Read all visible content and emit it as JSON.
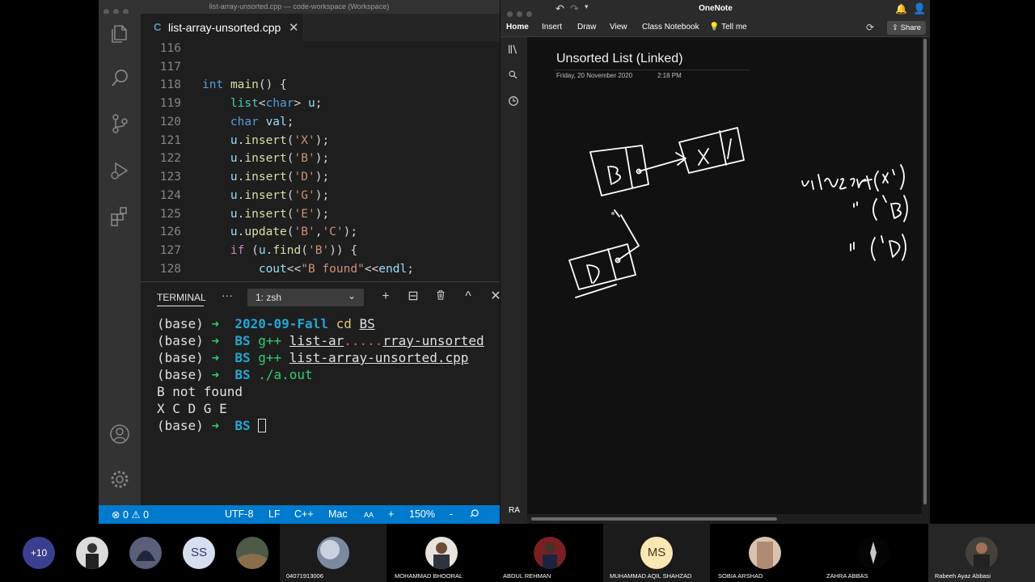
{
  "vscode": {
    "window_title": "list-array-unsorted.cpp — code-workspace (Workspace)",
    "tab": {
      "icon": "C",
      "label": "list-array-unsorted.cpp",
      "close": "✕"
    },
    "more": "···",
    "code_lines": [
      {
        "n": "116",
        "text": ""
      },
      {
        "n": "117",
        "text": ""
      },
      {
        "n": "118",
        "text": "int main() {"
      },
      {
        "n": "119",
        "text": "    list<char> u;"
      },
      {
        "n": "120",
        "text": "    char val;"
      },
      {
        "n": "121",
        "text": "    u.insert('X');"
      },
      {
        "n": "122",
        "text": "    u.insert('B');"
      },
      {
        "n": "123",
        "text": "    u.insert('D');"
      },
      {
        "n": "124",
        "text": "    u.insert('G');"
      },
      {
        "n": "125",
        "text": "    u.insert('E');"
      },
      {
        "n": "126",
        "text": "    u.update('B','C');"
      },
      {
        "n": "127",
        "text": "    if (u.find('B')) {"
      },
      {
        "n": "128",
        "text": "        cout<<\"B found\"<<endl;"
      }
    ],
    "panel": {
      "tab": "TERMINAL",
      "more": "···",
      "terminal_select": "1: zsh",
      "buttons": [
        "+",
        "⊟",
        "🗑",
        "^",
        "✕"
      ]
    },
    "terminal": {
      "prompt": "(base)",
      "arrow": "➜",
      "lines": [
        {
          "dir": "2020-09-Fall",
          "cmd": "cd",
          "arg": "BS",
          "dots": ""
        },
        {
          "dir": "BS",
          "cmd": "g++",
          "arg": "list-ar",
          "dots": ".....",
          "arg2": "rray-unsorted"
        },
        {
          "dir": "BS",
          "cmd": "g++",
          "arg": "list-array-unsorted.cpp"
        },
        {
          "dir": "BS",
          "cmd": "./a.out"
        }
      ],
      "output": [
        "B not found",
        "X C D G E"
      ],
      "last_dir": "BS"
    },
    "status": {
      "errors": "0",
      "warnings": "0",
      "encoding": "UTF-8",
      "eol": "LF",
      "language": "C++",
      "platform": "Mac",
      "font_icon": "AA",
      "zoom_in": "+",
      "zoom": "150%",
      "zoom_out": "-"
    }
  },
  "onenote": {
    "app_title": "OneNote",
    "ribbon": [
      "Home",
      "Insert",
      "Draw",
      "View",
      "Class Notebook"
    ],
    "tell_me": "Tell me",
    "share": "Share",
    "page_title": "Unsorted List (Linked)",
    "page_date": "Friday, 20 November 2020",
    "page_time": "2:18 PM",
    "user_initials": "RA",
    "ink_labels": [
      "B",
      "X",
      "D",
      "u.insert('X')",
      "('B')",
      "('D')"
    ]
  },
  "meeting": {
    "overflow_count": "+10",
    "participants": [
      {
        "initials": "",
        "name": ""
      },
      {
        "initials": "",
        "name": ""
      },
      {
        "initials": "SS",
        "name": ""
      },
      {
        "initials": "",
        "name": ""
      },
      {
        "initials": "",
        "name": "04071913006"
      },
      {
        "initials": "",
        "name": "MOHAMMAD BHOORAL"
      },
      {
        "initials": "",
        "name": "ABDUL REHMAN"
      },
      {
        "initials": "MS",
        "name": "MUHAMMAD AQIL SHAHZAD"
      },
      {
        "initials": "",
        "name": "SOBIA ARSHAD"
      },
      {
        "initials": "",
        "name": "ZAHRA ABBAS"
      },
      {
        "initials": "",
        "name": "Rabeeh Ayaz Abbasi"
      }
    ]
  },
  "colors": {
    "vscode_status": "#007acc",
    "terminal_arrow": "#2ecc71",
    "terminal_dir": "#23a6d5",
    "keyword": "#569cd6"
  }
}
